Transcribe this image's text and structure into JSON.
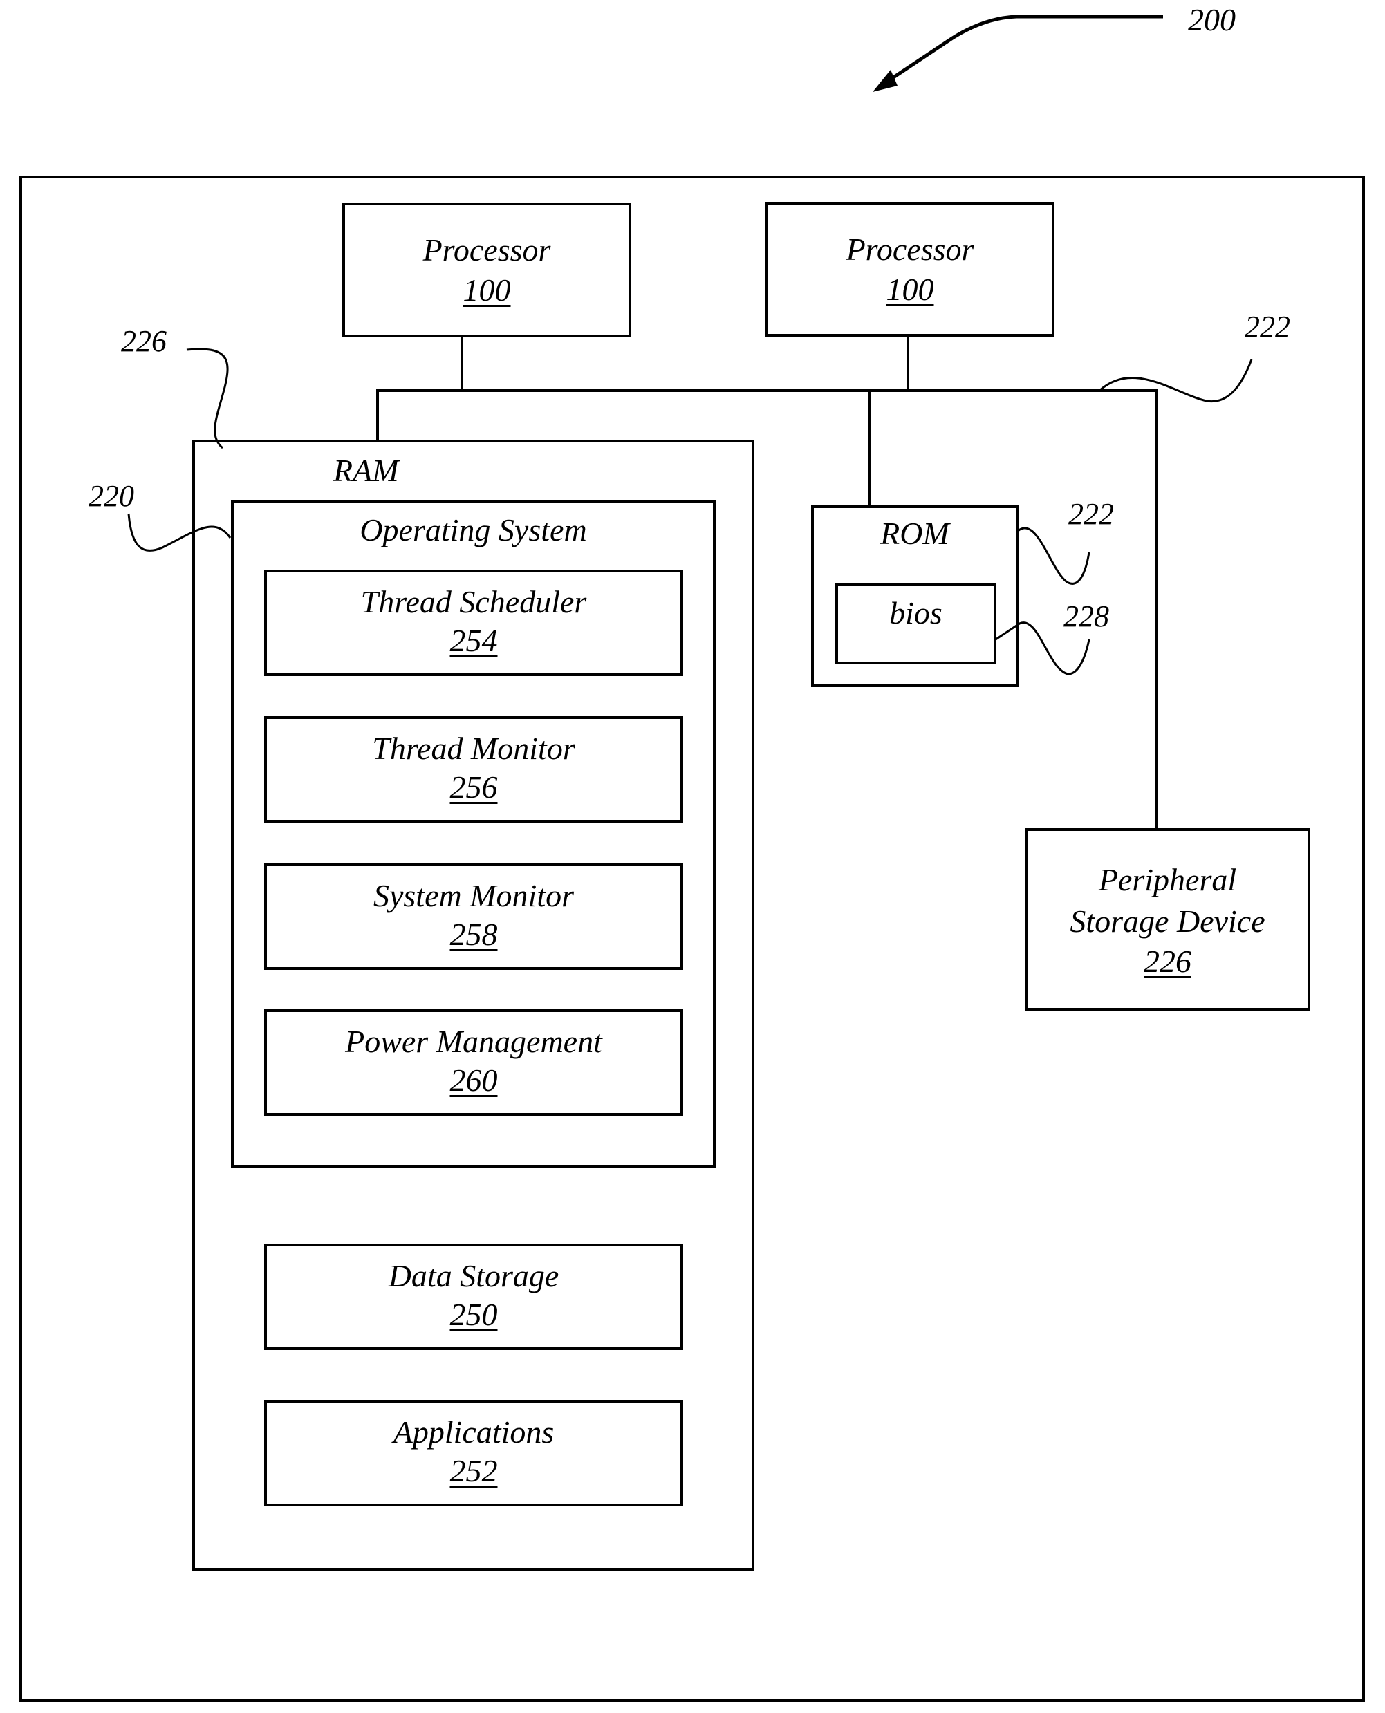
{
  "figure": {
    "reference": "200",
    "processors": [
      {
        "label": "Processor",
        "number": "100"
      },
      {
        "label": "Processor",
        "number": "100"
      }
    ],
    "ram": {
      "label": "RAM",
      "ref": "226",
      "os": {
        "label": "Operating System",
        "ref": "220",
        "modules": [
          {
            "label": "Thread Scheduler",
            "number": "254"
          },
          {
            "label": "Thread Monitor",
            "number": "256"
          },
          {
            "label": "System Monitor",
            "number": "258"
          },
          {
            "label": "Power Management",
            "number": "260"
          }
        ]
      },
      "modules": [
        {
          "label": "Data Storage",
          "number": "250"
        },
        {
          "label": "Applications",
          "number": "252"
        }
      ]
    },
    "bus_ref": "222",
    "rom": {
      "label": "ROM",
      "ref": "222",
      "bios": {
        "label": "bios",
        "ref": "228"
      }
    },
    "peripheral": {
      "line1": "Peripheral",
      "line2": "Storage Device",
      "number": "226"
    }
  }
}
